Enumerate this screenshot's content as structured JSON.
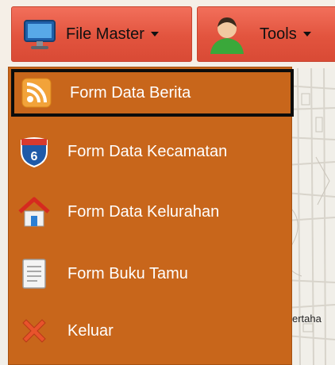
{
  "menubar": {
    "file_master": {
      "label": "File Master",
      "icon": "monitor-icon"
    },
    "tools": {
      "label": "Tools",
      "icon": "user-icon"
    }
  },
  "dropdown": {
    "items": [
      {
        "label": "Form Data Berita",
        "icon": "rss-icon",
        "selected": true
      },
      {
        "label": "Form Data Kecamatan",
        "icon": "shield-6-icon"
      },
      {
        "label": "Form Data Kelurahan",
        "icon": "home-icon"
      },
      {
        "label": "Form Buku Tamu",
        "icon": "document-icon"
      },
      {
        "label": "Keluar",
        "icon": "close-x-icon"
      }
    ]
  },
  "map": {
    "label_fragment": "ertaha"
  },
  "colors": {
    "menu_button": "#e2543e",
    "dropdown_bg": "#c8661b",
    "selected_border": "#0c0c0c",
    "map_bg": "#f1efe9"
  }
}
